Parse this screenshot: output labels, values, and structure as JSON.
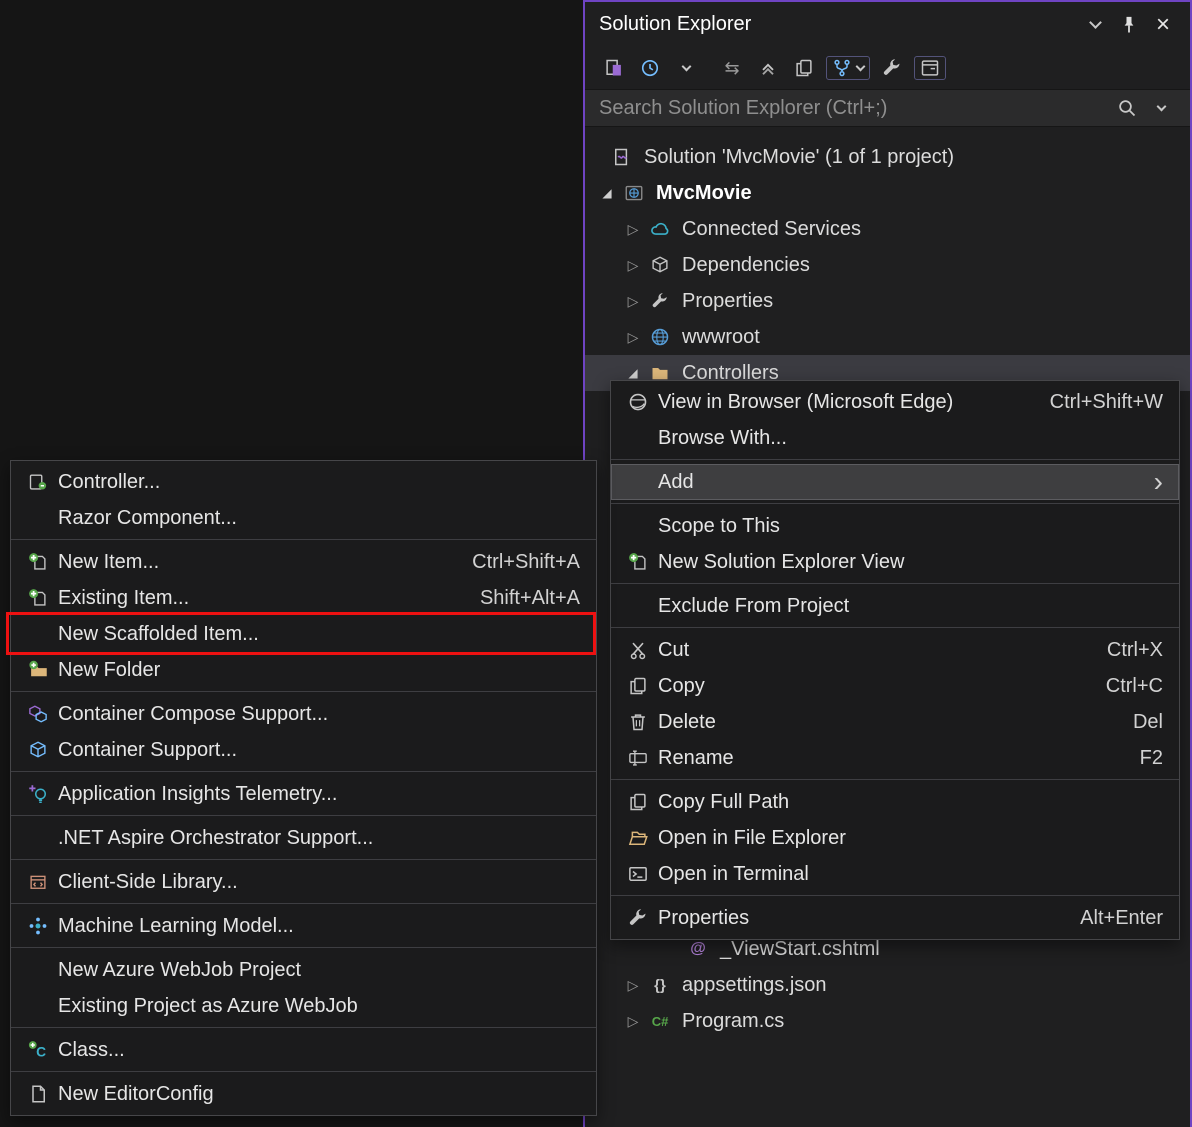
{
  "colors": {
    "panel_accent_border": "#6F44C3",
    "red_highlight_border": "#EE1111",
    "selection_background": "#3B3B41",
    "menu_highlight_background": "#3E3E40",
    "menu_background": "#1B1B1C"
  },
  "glyphs": {
    "expanded": "◢",
    "collapsed": "▷",
    "close": "×",
    "submenu_arrow": "›",
    "nav_arrows": "⇆",
    "razor_at": "@",
    "json_braces": "{}",
    "csharp": "C#",
    "class_c": "C"
  },
  "solution_explorer": {
    "title": "Solution Explorer",
    "search_placeholder": "Search Solution Explorer (Ctrl+;)"
  },
  "tree": {
    "items": [
      {
        "label": "Solution 'MvcMovie' (1 of 1 project)",
        "icon": "solution"
      },
      {
        "label": "MvcMovie",
        "icon": "project",
        "expanded": true,
        "bold": true
      },
      {
        "label": "Connected Services",
        "icon": "cloud",
        "collapsed": true
      },
      {
        "label": "Dependencies",
        "icon": "package",
        "collapsed": true
      },
      {
        "label": "Properties",
        "icon": "wrench",
        "collapsed": true
      },
      {
        "label": "wwwroot",
        "icon": "globe",
        "collapsed": true
      },
      {
        "label": "Controllers",
        "icon": "folder",
        "expanded": true,
        "selected": true
      },
      {
        "label": "_ViewStart.cshtml",
        "icon": "razor"
      },
      {
        "label": "appsettings.json",
        "icon": "json",
        "collapsed": true
      },
      {
        "label": "Program.cs",
        "icon": "csharp",
        "collapsed": true
      }
    ]
  },
  "context_menu": {
    "items": [
      {
        "label": "View in Browser (Microsoft Edge)",
        "shortcut": "Ctrl+Shift+W",
        "icon": "browser"
      },
      {
        "label": "Browse With..."
      },
      {
        "label": "Add",
        "submenu": true,
        "highlighted": true
      },
      {
        "label": "Scope to This"
      },
      {
        "label": "New Solution Explorer View",
        "icon": "new-view"
      },
      {
        "label": "Exclude From Project"
      },
      {
        "label": "Cut",
        "shortcut": "Ctrl+X",
        "icon": "scissors"
      },
      {
        "label": "Copy",
        "shortcut": "Ctrl+C",
        "icon": "copy"
      },
      {
        "label": "Delete",
        "shortcut": "Del",
        "icon": "trash"
      },
      {
        "label": "Rename",
        "shortcut": "F2",
        "icon": "rename"
      },
      {
        "label": "Copy Full Path",
        "icon": "copy"
      },
      {
        "label": "Open in File Explorer",
        "icon": "folder-open"
      },
      {
        "label": "Open in Terminal",
        "icon": "terminal"
      },
      {
        "label": "Properties",
        "shortcut": "Alt+Enter",
        "icon": "wrench"
      }
    ]
  },
  "add_submenu": {
    "items": [
      {
        "label": "Controller...",
        "icon": "controller"
      },
      {
        "label": "Razor Component..."
      },
      {
        "label": "New Item...",
        "shortcut": "Ctrl+Shift+A",
        "icon": "new-item"
      },
      {
        "label": "Existing Item...",
        "shortcut": "Shift+Alt+A",
        "icon": "existing-item"
      },
      {
        "label": "New Scaffolded Item...",
        "red_highlight": true
      },
      {
        "label": "New Folder",
        "icon": "new-folder"
      },
      {
        "label": "Container Compose Support...",
        "icon": "cubes"
      },
      {
        "label": "Container Support...",
        "icon": "cube"
      },
      {
        "label": "Application Insights Telemetry...",
        "icon": "insights"
      },
      {
        "label": ".NET Aspire Orchestrator Support..."
      },
      {
        "label": "Client-Side Library...",
        "icon": "client-library"
      },
      {
        "label": "Machine Learning Model...",
        "icon": "ml-model"
      },
      {
        "label": "New Azure WebJob Project"
      },
      {
        "label": "Existing Project as Azure WebJob"
      },
      {
        "label": "Class...",
        "icon": "class"
      },
      {
        "label": "New EditorConfig",
        "icon": "document"
      }
    ]
  }
}
